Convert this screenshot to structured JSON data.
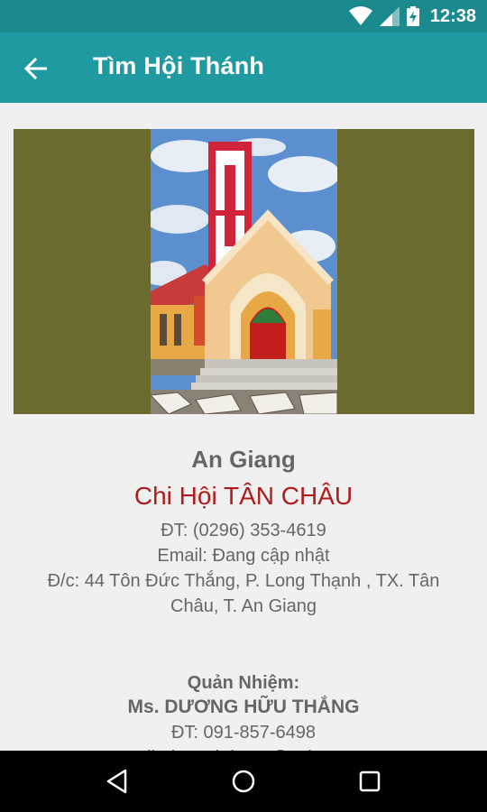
{
  "status_bar": {
    "time": "12:38"
  },
  "app_bar": {
    "title": "Tìm Hội Thánh"
  },
  "church": {
    "province": "An Giang",
    "name": "Chi Hội TÂN CHÂU",
    "phone": "ĐT: (0296) 353-4619",
    "email": "Email: Đang cập nhật",
    "address": "Đ/c: 44 Tôn Đức Thắng, P. Long Thạnh , TX. Tân Châu, T. An Giang"
  },
  "pastor": {
    "label": "Quản Nhiệm:",
    "name": "Ms. DƯƠNG HỮU THẮNG",
    "phone": "ĐT: 091-857-6498",
    "email": "Email: duonghthang@yahoo.com"
  },
  "colors": {
    "status_bar": "#1a8a8e",
    "app_bar": "#1f9aa0",
    "hero_bg": "#6b6a2f",
    "church_name": "#b01c1c",
    "body_text": "#666666"
  }
}
